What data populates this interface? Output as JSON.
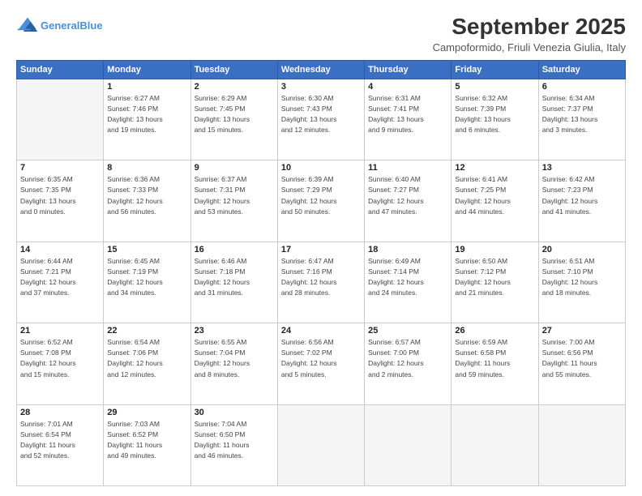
{
  "header": {
    "logo_line1": "General",
    "logo_line2": "Blue",
    "title": "September 2025",
    "subtitle": "Campoformido, Friuli Venezia Giulia, Italy"
  },
  "columns": [
    "Sunday",
    "Monday",
    "Tuesday",
    "Wednesday",
    "Thursday",
    "Friday",
    "Saturday"
  ],
  "weeks": [
    [
      {
        "day": "",
        "info": ""
      },
      {
        "day": "1",
        "info": "Sunrise: 6:27 AM\nSunset: 7:46 PM\nDaylight: 13 hours\nand 19 minutes."
      },
      {
        "day": "2",
        "info": "Sunrise: 6:29 AM\nSunset: 7:45 PM\nDaylight: 13 hours\nand 15 minutes."
      },
      {
        "day": "3",
        "info": "Sunrise: 6:30 AM\nSunset: 7:43 PM\nDaylight: 13 hours\nand 12 minutes."
      },
      {
        "day": "4",
        "info": "Sunrise: 6:31 AM\nSunset: 7:41 PM\nDaylight: 13 hours\nand 9 minutes."
      },
      {
        "day": "5",
        "info": "Sunrise: 6:32 AM\nSunset: 7:39 PM\nDaylight: 13 hours\nand 6 minutes."
      },
      {
        "day": "6",
        "info": "Sunrise: 6:34 AM\nSunset: 7:37 PM\nDaylight: 13 hours\nand 3 minutes."
      }
    ],
    [
      {
        "day": "7",
        "info": "Sunrise: 6:35 AM\nSunset: 7:35 PM\nDaylight: 13 hours\nand 0 minutes."
      },
      {
        "day": "8",
        "info": "Sunrise: 6:36 AM\nSunset: 7:33 PM\nDaylight: 12 hours\nand 56 minutes."
      },
      {
        "day": "9",
        "info": "Sunrise: 6:37 AM\nSunset: 7:31 PM\nDaylight: 12 hours\nand 53 minutes."
      },
      {
        "day": "10",
        "info": "Sunrise: 6:39 AM\nSunset: 7:29 PM\nDaylight: 12 hours\nand 50 minutes."
      },
      {
        "day": "11",
        "info": "Sunrise: 6:40 AM\nSunset: 7:27 PM\nDaylight: 12 hours\nand 47 minutes."
      },
      {
        "day": "12",
        "info": "Sunrise: 6:41 AM\nSunset: 7:25 PM\nDaylight: 12 hours\nand 44 minutes."
      },
      {
        "day": "13",
        "info": "Sunrise: 6:42 AM\nSunset: 7:23 PM\nDaylight: 12 hours\nand 41 minutes."
      }
    ],
    [
      {
        "day": "14",
        "info": "Sunrise: 6:44 AM\nSunset: 7:21 PM\nDaylight: 12 hours\nand 37 minutes."
      },
      {
        "day": "15",
        "info": "Sunrise: 6:45 AM\nSunset: 7:19 PM\nDaylight: 12 hours\nand 34 minutes."
      },
      {
        "day": "16",
        "info": "Sunrise: 6:46 AM\nSunset: 7:18 PM\nDaylight: 12 hours\nand 31 minutes."
      },
      {
        "day": "17",
        "info": "Sunrise: 6:47 AM\nSunset: 7:16 PM\nDaylight: 12 hours\nand 28 minutes."
      },
      {
        "day": "18",
        "info": "Sunrise: 6:49 AM\nSunset: 7:14 PM\nDaylight: 12 hours\nand 24 minutes."
      },
      {
        "day": "19",
        "info": "Sunrise: 6:50 AM\nSunset: 7:12 PM\nDaylight: 12 hours\nand 21 minutes."
      },
      {
        "day": "20",
        "info": "Sunrise: 6:51 AM\nSunset: 7:10 PM\nDaylight: 12 hours\nand 18 minutes."
      }
    ],
    [
      {
        "day": "21",
        "info": "Sunrise: 6:52 AM\nSunset: 7:08 PM\nDaylight: 12 hours\nand 15 minutes."
      },
      {
        "day": "22",
        "info": "Sunrise: 6:54 AM\nSunset: 7:06 PM\nDaylight: 12 hours\nand 12 minutes."
      },
      {
        "day": "23",
        "info": "Sunrise: 6:55 AM\nSunset: 7:04 PM\nDaylight: 12 hours\nand 8 minutes."
      },
      {
        "day": "24",
        "info": "Sunrise: 6:56 AM\nSunset: 7:02 PM\nDaylight: 12 hours\nand 5 minutes."
      },
      {
        "day": "25",
        "info": "Sunrise: 6:57 AM\nSunset: 7:00 PM\nDaylight: 12 hours\nand 2 minutes."
      },
      {
        "day": "26",
        "info": "Sunrise: 6:59 AM\nSunset: 6:58 PM\nDaylight: 11 hours\nand 59 minutes."
      },
      {
        "day": "27",
        "info": "Sunrise: 7:00 AM\nSunset: 6:56 PM\nDaylight: 11 hours\nand 55 minutes."
      }
    ],
    [
      {
        "day": "28",
        "info": "Sunrise: 7:01 AM\nSunset: 6:54 PM\nDaylight: 11 hours\nand 52 minutes."
      },
      {
        "day": "29",
        "info": "Sunrise: 7:03 AM\nSunset: 6:52 PM\nDaylight: 11 hours\nand 49 minutes."
      },
      {
        "day": "30",
        "info": "Sunrise: 7:04 AM\nSunset: 6:50 PM\nDaylight: 11 hours\nand 46 minutes."
      },
      {
        "day": "",
        "info": ""
      },
      {
        "day": "",
        "info": ""
      },
      {
        "day": "",
        "info": ""
      },
      {
        "day": "",
        "info": ""
      }
    ]
  ]
}
